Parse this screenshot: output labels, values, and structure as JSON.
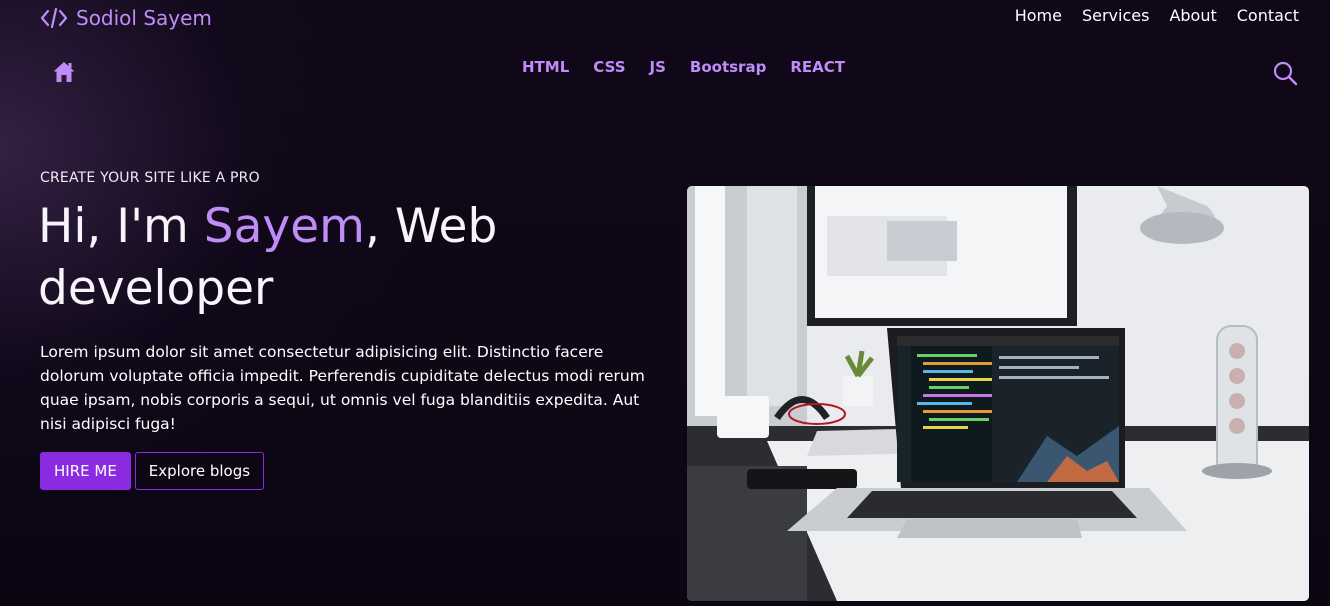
{
  "brand": {
    "name": "Sodiol Sayem",
    "icon": "code-icon"
  },
  "top_nav": [
    {
      "label": "Home"
    },
    {
      "label": "Services"
    },
    {
      "label": "About"
    },
    {
      "label": "Contact"
    }
  ],
  "category_nav": {
    "home_icon": "home-icon",
    "items": [
      {
        "label": "HTML"
      },
      {
        "label": "CSS"
      },
      {
        "label": "JS"
      },
      {
        "label": "Bootsrap"
      },
      {
        "label": "REACT"
      }
    ],
    "search_icon": "search-icon"
  },
  "hero": {
    "eyebrow": "CREATE YOUR SITE LIKE A PRO",
    "headline_prefix": "Hi, I'm ",
    "headline_name": "Sayem",
    "headline_suffix": ", Web developer",
    "description": "Lorem ipsum dolor sit amet consectetur adipisicing elit. Distinctio facere dolorum voluptate officia impedit. Perferendis cupiditate delectus modi rerum quae ipsam, nobis corporis a sequi, ut omnis vel fuga blanditiis expedita. Aut nisi adipisci fuga!",
    "primary_button": "HIRE ME",
    "secondary_button": "Explore blogs"
  },
  "colors": {
    "accent": "#c08cf8",
    "button_primary": "#8a2be2",
    "background": "#0c0614"
  }
}
